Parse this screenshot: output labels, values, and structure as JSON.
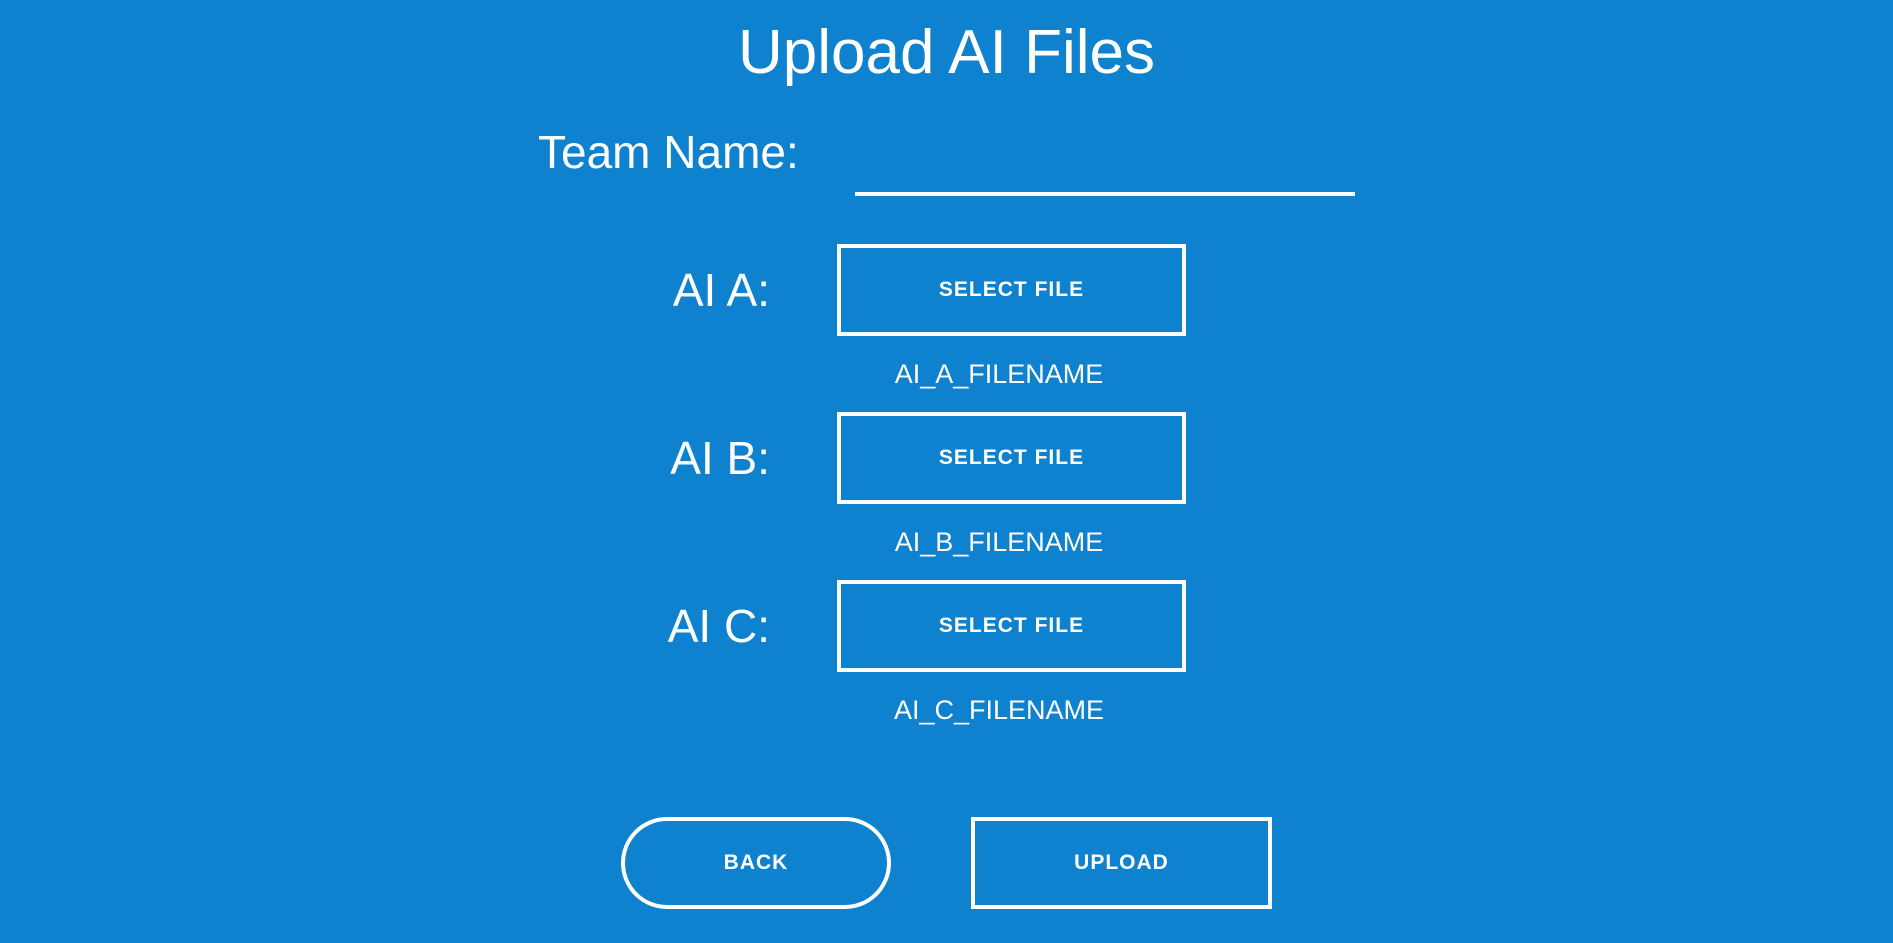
{
  "page": {
    "title": "Upload AI Files",
    "background_color": "#0e82ce",
    "foreground_color": "#ffffff"
  },
  "team": {
    "label": "Team Name:",
    "value": "",
    "placeholder": ""
  },
  "ai_slots": [
    {
      "label": "AI A:",
      "button_label": "SELECT FILE",
      "filename": "AI_A_FILENAME"
    },
    {
      "label": "AI B:",
      "button_label": "SELECT FILE",
      "filename": "AI_B_FILENAME"
    },
    {
      "label": "AI C:",
      "button_label": "SELECT FILE",
      "filename": "AI_C_FILENAME"
    }
  ],
  "actions": {
    "back_label": "BACK",
    "upload_label": "UPLOAD"
  }
}
